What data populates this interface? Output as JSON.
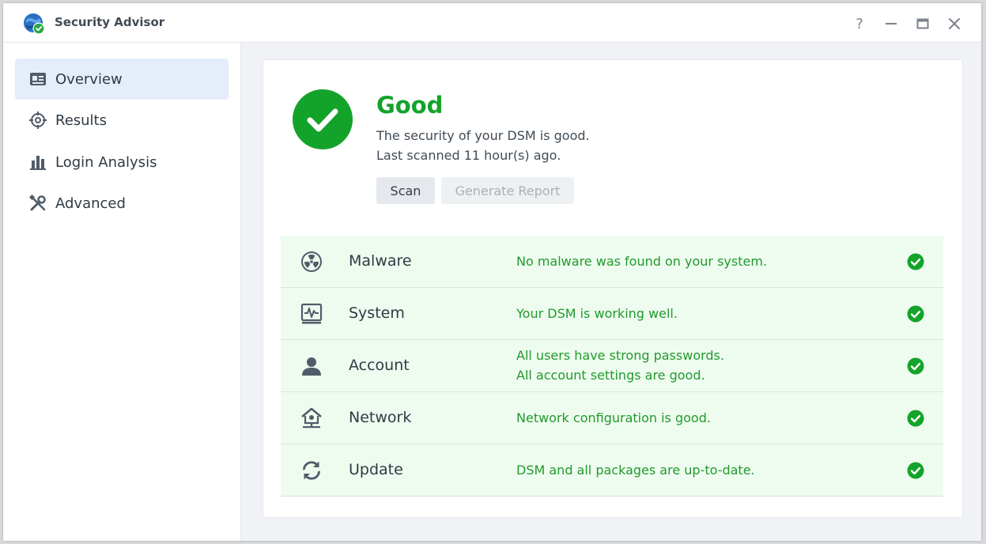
{
  "window": {
    "title": "Security Advisor",
    "controls": {
      "help": "?",
      "help_icon": "help-icon",
      "minimize_icon": "minimize-icon",
      "maximize_icon": "maximize-icon",
      "close_icon": "close-icon"
    }
  },
  "sidebar": {
    "items": [
      {
        "label": "Overview",
        "icon": "overview-icon",
        "active": true
      },
      {
        "label": "Results",
        "icon": "crosshair-icon",
        "active": false
      },
      {
        "label": "Login Analysis",
        "icon": "bar-chart-icon",
        "active": false
      },
      {
        "label": "Advanced",
        "icon": "tools-icon",
        "active": false
      }
    ]
  },
  "overview": {
    "status": "Good",
    "status_icon": "check-circle-icon",
    "status_color": "#13a32a",
    "message": "The security of your DSM is good.",
    "last_scanned": "Last scanned 11 hour(s) ago.",
    "scan_button": "Scan",
    "report_button": "Generate Report"
  },
  "categories": [
    {
      "name": "Malware",
      "icon": "radiation-icon",
      "description": [
        "No malware was found on your system."
      ],
      "status": "ok"
    },
    {
      "name": "System",
      "icon": "system-monitor-icon",
      "description": [
        "Your DSM is working well."
      ],
      "status": "ok"
    },
    {
      "name": "Account",
      "icon": "user-icon",
      "description": [
        "All users have strong passwords.",
        "All account settings are good."
      ],
      "status": "ok"
    },
    {
      "name": "Network",
      "icon": "network-home-icon",
      "description": [
        "Network configuration is good."
      ],
      "status": "ok"
    },
    {
      "name": "Update",
      "icon": "refresh-icon",
      "description": [
        "DSM and all packages are up-to-date."
      ],
      "status": "ok"
    }
  ],
  "colors": {
    "ok_green": "#13a32a",
    "row_bg": "#eefbef",
    "active_nav_bg": "#e4eefa"
  }
}
